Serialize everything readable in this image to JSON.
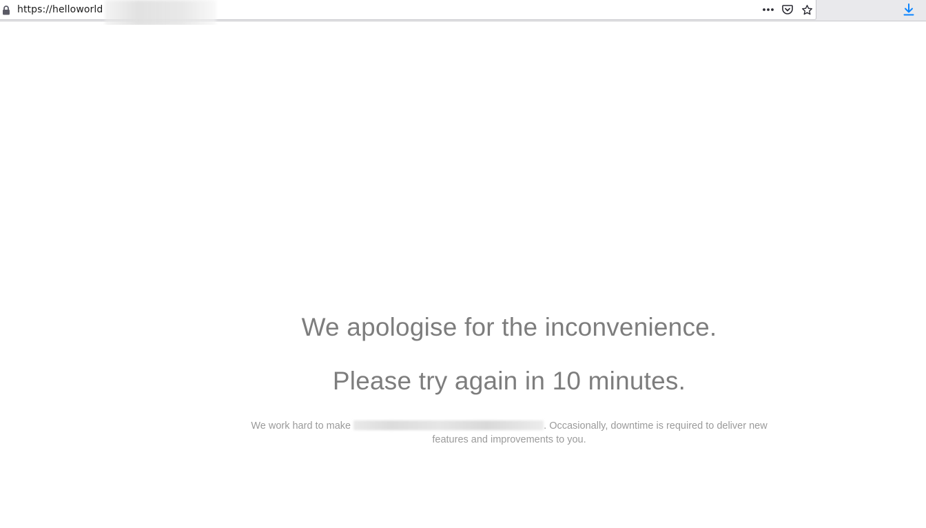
{
  "browser": {
    "url_visible": "https://helloworld",
    "icons": [
      "lock-icon",
      "more-actions-icon",
      "pocket-icon",
      "bookmark-star-icon",
      "download-icon"
    ],
    "download_icon_color": "#0a84ff"
  },
  "page": {
    "heading_1": "We apologise for the inconvenience.",
    "heading_2": "Please try again in 10 minutes.",
    "body_prefix": "We work hard to make",
    "body_suffix": ". Occasionally, downtime is required to deliver new features and improvements to you.",
    "text_color": "#7d7d7d"
  }
}
